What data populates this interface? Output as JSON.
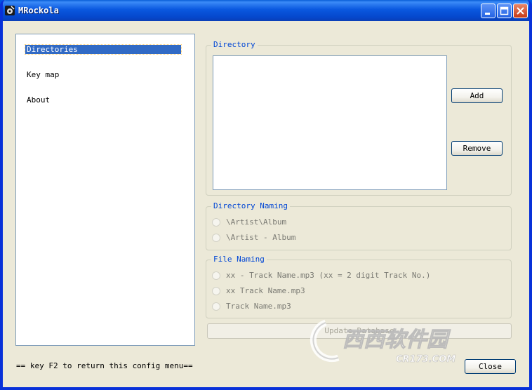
{
  "window": {
    "title": "MRockola"
  },
  "nav": {
    "items": [
      "Directories",
      "Key map",
      "About"
    ],
    "selected": "Directories"
  },
  "directory_group": {
    "title": "Directory",
    "add_label": "Add",
    "remove_label": "Remove"
  },
  "directory_naming": {
    "title": "Directory Naming",
    "options": [
      "\\Artist\\Album",
      "\\Artist - Album"
    ]
  },
  "file_naming": {
    "title": "File Naming",
    "options": [
      "xx - Track Name.mp3 (xx = 2 digit Track No.)",
      "xx Track Name.mp3",
      "Track Name.mp3"
    ]
  },
  "update_label": "Update Database",
  "footer_hint": "== key F2 to return this config menu==",
  "close_label": "Close",
  "watermark": {
    "text": "西西软件园",
    "sub": "CR173.COM"
  },
  "colors": {
    "titlebar": "#0a58df",
    "selection": "#316ac5",
    "group_title": "#0046d5"
  }
}
